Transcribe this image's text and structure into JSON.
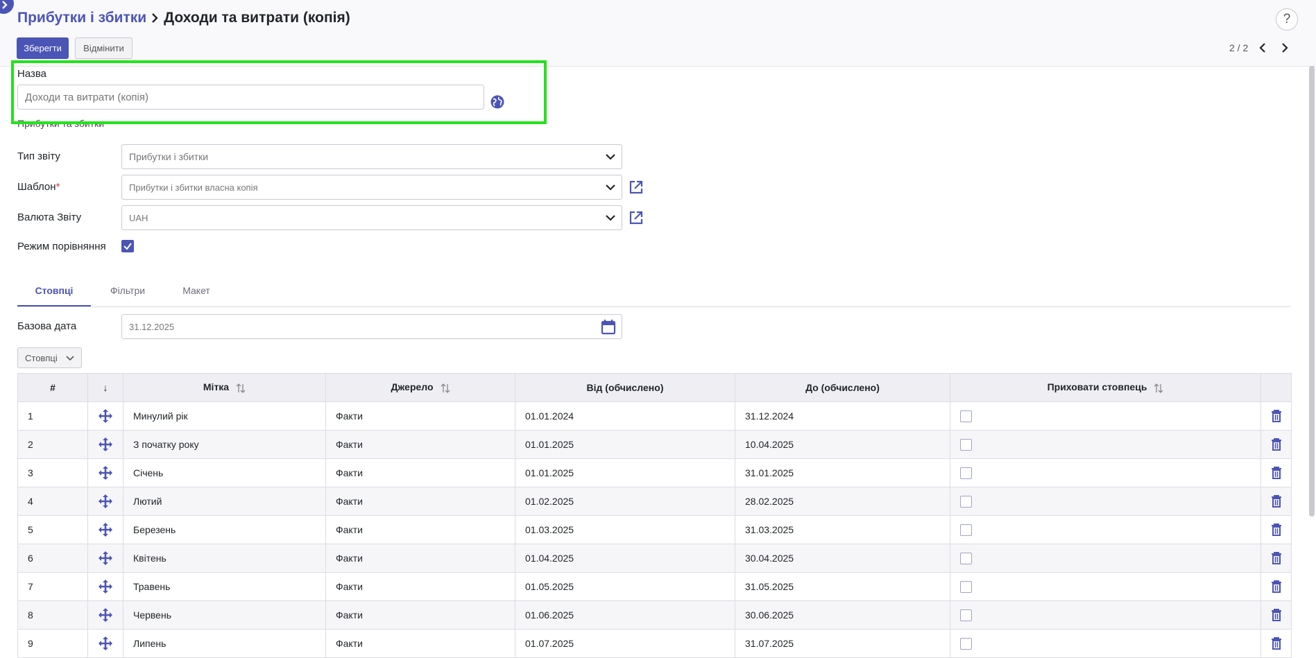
{
  "breadcrumb": {
    "parent": "Прибутки і збитки",
    "current": "Доходи та витрати (копія)"
  },
  "toolbar": {
    "save_label": "Зберегти",
    "cancel_label": "Відмінити",
    "pager_text": "2 / 2",
    "help_label": "?"
  },
  "form": {
    "name_label": "Назва",
    "name_value": "Доходи та витрати (копія)",
    "sub_label": "Прибутки та збитки",
    "report_type_label": "Тип звіту",
    "report_type_value": "Прибутки і збитки",
    "template_label": "Шаблон",
    "required_mark": "*",
    "template_value": "Прибутки і збитки власна копія",
    "currency_label": "Валюта Звіту",
    "currency_value": "UAH",
    "compare_label": "Режим порівняння",
    "compare_checked": true
  },
  "tabs": [
    {
      "label": "Стовпці",
      "active": true
    },
    {
      "label": "Фільтри",
      "active": false
    },
    {
      "label": "Макет",
      "active": false
    }
  ],
  "base_date": {
    "label": "Базова дата",
    "value": "31.12.2025"
  },
  "columns_dropdown": "Стовпці",
  "table": {
    "headers": [
      "#",
      "↓",
      "Мітка",
      "Джерело",
      "Від (обчислено)",
      "До (обчислено)",
      "Приховати стовпець",
      ""
    ],
    "rows": [
      {
        "n": "1",
        "label": "Минулий рік",
        "source": "Факти",
        "from": "01.01.2024",
        "to": "31.12.2024"
      },
      {
        "n": "2",
        "label": "З початку року",
        "source": "Факти",
        "from": "01.01.2025",
        "to": "10.04.2025"
      },
      {
        "n": "3",
        "label": "Січень",
        "source": "Факти",
        "from": "01.01.2025",
        "to": "31.01.2025"
      },
      {
        "n": "4",
        "label": "Лютий",
        "source": "Факти",
        "from": "01.02.2025",
        "to": "28.02.2025"
      },
      {
        "n": "5",
        "label": "Березень",
        "source": "Факти",
        "from": "01.03.2025",
        "to": "31.03.2025"
      },
      {
        "n": "6",
        "label": "Квітень",
        "source": "Факти",
        "from": "01.04.2025",
        "to": "30.04.2025"
      },
      {
        "n": "7",
        "label": "Травень",
        "source": "Факти",
        "from": "01.05.2025",
        "to": "31.05.2025"
      },
      {
        "n": "8",
        "label": "Червень",
        "source": "Факти",
        "from": "01.06.2025",
        "to": "30.06.2025"
      },
      {
        "n": "9",
        "label": "Липень",
        "source": "Факти",
        "from": "01.07.2025",
        "to": "31.07.2025"
      }
    ]
  },
  "icons": {
    "corner": "chevron-right-icon",
    "globe": "globe-icon",
    "external": "external-link-icon",
    "calendar": "calendar-icon",
    "move": "move-icon",
    "trash": "trash-icon",
    "sort": "sort-icon"
  },
  "colors": {
    "accent": "#4b55b5",
    "highlight": "#22e31a",
    "required": "#e03a3a"
  }
}
